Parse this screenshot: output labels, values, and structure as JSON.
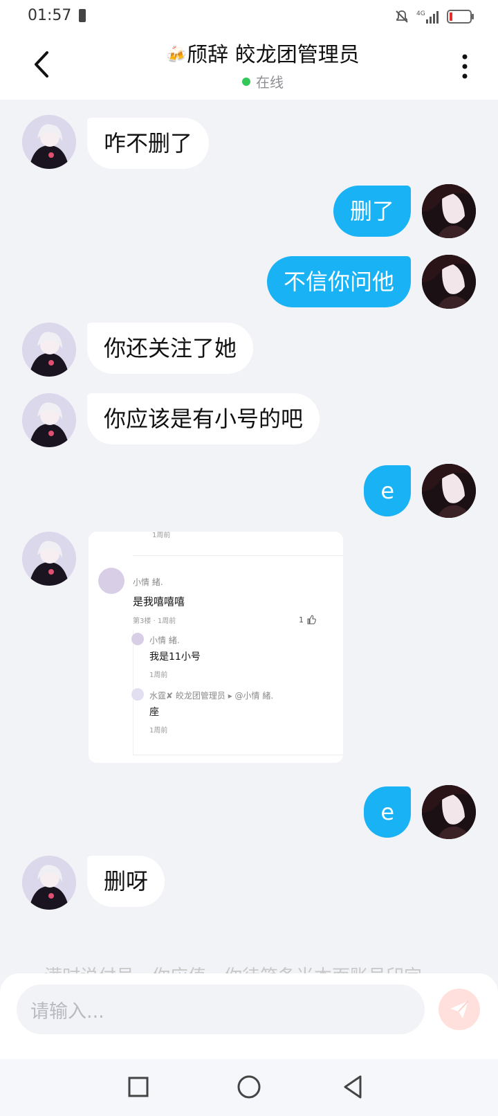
{
  "status_bar": {
    "time": "01:57",
    "network": "4G",
    "icons": [
      "battery-saver-icon",
      "mute-icon",
      "signal-icon",
      "battery-icon"
    ]
  },
  "header": {
    "title": "颀辞 皎龙团管理员",
    "title_left_emoji": "🍻",
    "title_mid_emoji": "🍡",
    "title_right_emoji": "✺",
    "status": "在线",
    "status_color": "#34c759",
    "back_icon": "chevron-left-icon",
    "more_icon": "more-vertical-icon"
  },
  "messages": [
    {
      "side": "left",
      "text": "咋不删了"
    },
    {
      "side": "right",
      "text": "删了"
    },
    {
      "side": "right",
      "text": "不信你问他"
    },
    {
      "side": "left",
      "text": "你还关注了她"
    },
    {
      "side": "left",
      "text": "你应该是有小号的吧"
    },
    {
      "side": "right",
      "text": "e"
    },
    {
      "side": "left",
      "type": "image",
      "image": {
        "partial_top": "1周前",
        "comment": {
          "name": "小情 緒.",
          "text": "是我嘻嘻嘻",
          "meta": "第3楼 · 1周前",
          "likes": "1"
        },
        "replies": [
          {
            "name": "小情 緒.",
            "text": "我是11小号",
            "meta": "1周前"
          },
          {
            "name": "水霆✘ 皎龙团管理员",
            "reply_to": "▸ @小情 緒.",
            "text": "座",
            "meta": "1周前"
          }
        ]
      }
    },
    {
      "side": "right",
      "text": "e"
    },
    {
      "side": "left",
      "text": "删呀"
    }
  ],
  "partial_text": "满时说付号，你应值，你待笑条当本面账号印完",
  "input": {
    "placeholder": "请输入...",
    "send_icon": "paper-plane-icon"
  },
  "colors": {
    "accent": "#19b2f5",
    "background": "#f2f3f7",
    "send_button_bg": "#ffe0dc",
    "send_icon": "#ffffff"
  },
  "nav": {
    "icons": [
      "square-icon",
      "circle-icon",
      "triangle-back-icon"
    ]
  }
}
